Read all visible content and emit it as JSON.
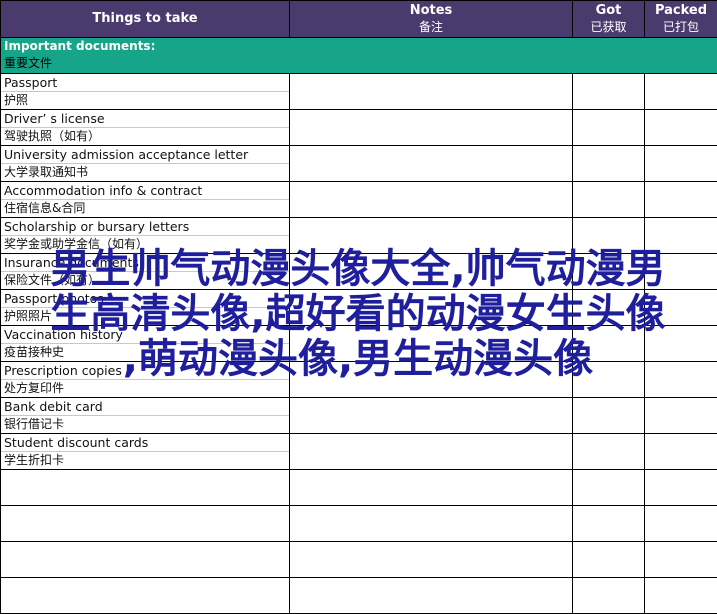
{
  "header": {
    "col1": "Things to take",
    "col2_en": "Notes",
    "col2_zh": "备注",
    "col3_en": "Got",
    "col3_zh": "已获取",
    "col4_en": "Packed",
    "col4_zh": "已打包"
  },
  "section": {
    "en": "Important documents:",
    "zh": "重要文件"
  },
  "items": [
    {
      "en": "Passport",
      "zh": "护照"
    },
    {
      "en": "Driver’ s license",
      "zh": "驾驶执照（如有）"
    },
    {
      "en": "University admission acceptance letter",
      "zh": "大学录取通知书"
    },
    {
      "en": "Accommodation info & contract",
      "zh": "住宿信息&合同"
    },
    {
      "en": "Scholarship or bursary letters",
      "zh": "奖学金或助学金信（如有）"
    },
    {
      "en": "Insurance documents",
      "zh": "保险文件（如有）"
    },
    {
      "en": "Passport photos",
      "zh": "护照照片"
    },
    {
      "en": "Vaccination history",
      "zh": "疫苗接种史"
    },
    {
      "en": "Prescription copies",
      "zh": "处方复印件"
    },
    {
      "en": "Bank debit card",
      "zh": "银行借记卡"
    },
    {
      "en": "Student discount cards",
      "zh": "学生折扣卡"
    }
  ],
  "watermark": {
    "line1": "男生帅气动漫头像大全,帅气动漫男",
    "line2": "生高清头像,超好看的动漫女生头像",
    "line3": ",萌动漫头像,男生动漫头像"
  }
}
